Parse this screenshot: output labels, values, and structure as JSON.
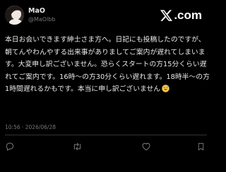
{
  "post": {
    "author": {
      "display_name": "MaO",
      "handle": "@MaOlbb",
      "avatar_icon": "avatar-photo"
    },
    "brand": {
      "wordmark": ".com",
      "logo_icon": "x-logo-icon"
    },
    "body_text": "本日お会いできます紳士さま方へ。日記にも投稿したのですが、朝てんやわんやする出来事がありましてご案内が遅れてしまいます。大変申し訳ございません。恐らくスタートの方15分くらい遅れてご案内です。16時〜の方30分くらい遅れます。18時半〜の方1時間遅れるかもです。本当に申し訳ございません",
    "body_emoji": "sweat-smile-emoji",
    "timestamp": "10:56 · 2026/06/28"
  },
  "actions": [
    {
      "name": "reply",
      "icon": "comment-icon"
    },
    {
      "name": "repost",
      "icon": "repost-icon"
    },
    {
      "name": "like",
      "icon": "heart-icon"
    },
    {
      "name": "bookmark",
      "icon": "bookmark-icon"
    }
  ],
  "colors": {
    "background": "#000000",
    "text_primary": "#e7e9ea",
    "text_secondary": "#71767b",
    "divider": "#2f3336"
  }
}
